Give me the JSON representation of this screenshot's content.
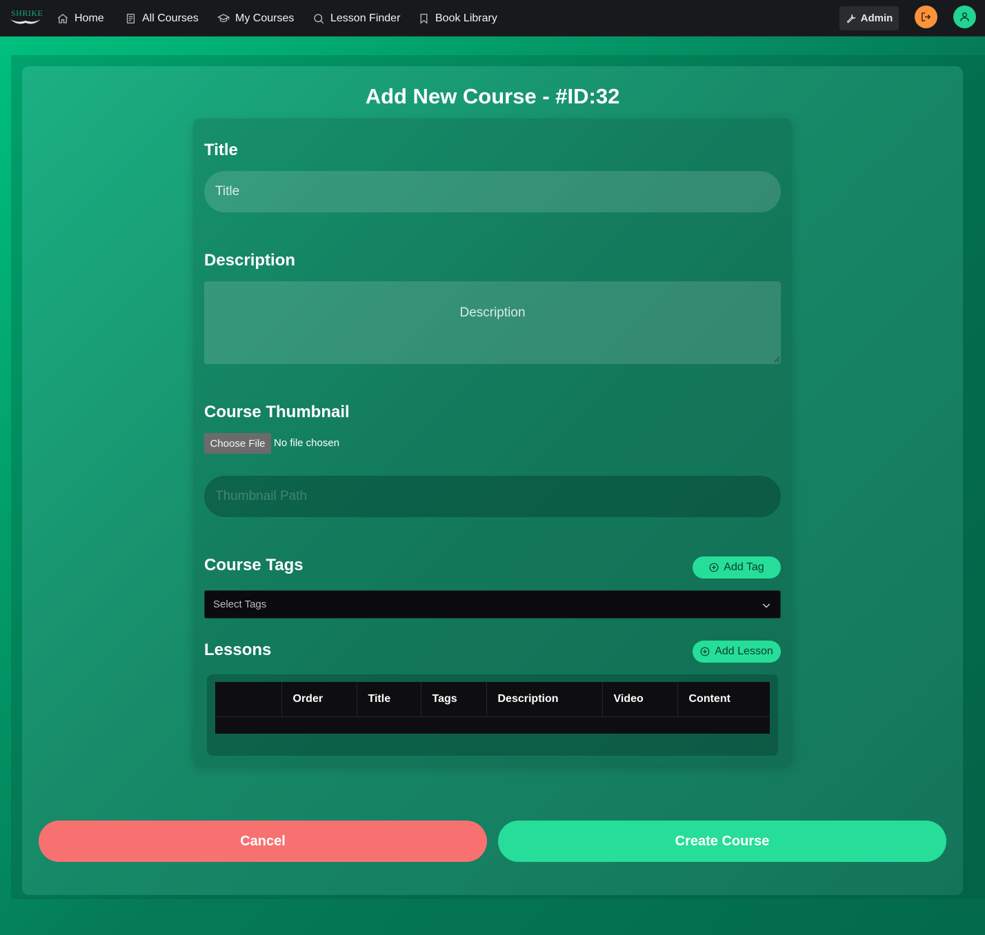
{
  "nav": {
    "logo_text": "SHRIKE",
    "items": [
      {
        "label": "Home",
        "icon": "home-icon"
      },
      {
        "label": "All Courses",
        "icon": "document-icon"
      },
      {
        "label": "My Courses",
        "icon": "graduation-cap-icon"
      },
      {
        "label": "Lesson Finder",
        "icon": "search-icon"
      },
      {
        "label": "Book Library",
        "icon": "bookmark-icon"
      }
    ],
    "admin_label": "Admin",
    "logout_icon": "logout-icon",
    "user_icon": "user-icon"
  },
  "page": {
    "title": "Add New Course - #ID:32"
  },
  "form": {
    "title_label": "Title",
    "title_placeholder": "Title",
    "description_label": "Description",
    "description_placeholder": "Description",
    "thumbnail_label": "Course Thumbnail",
    "choose_file_label": "Choose File",
    "file_status": "No file chosen",
    "thumbnail_path_placeholder": "Thumbnail Path",
    "tags_label": "Course Tags",
    "add_tag_label": "Add Tag",
    "select_tags_placeholder": "Select Tags",
    "lessons_label": "Lessons",
    "add_lesson_label": "Add Lesson",
    "lessons_table": {
      "columns": [
        "",
        "Order",
        "Title",
        "Tags",
        "Description",
        "Video",
        "Content"
      ],
      "rows": []
    }
  },
  "actions": {
    "cancel_label": "Cancel",
    "create_label": "Create Course"
  },
  "colors": {
    "accent": "#26de99",
    "cancel": "#f87171",
    "logout": "#fb923c",
    "navbar": "#18191c"
  }
}
